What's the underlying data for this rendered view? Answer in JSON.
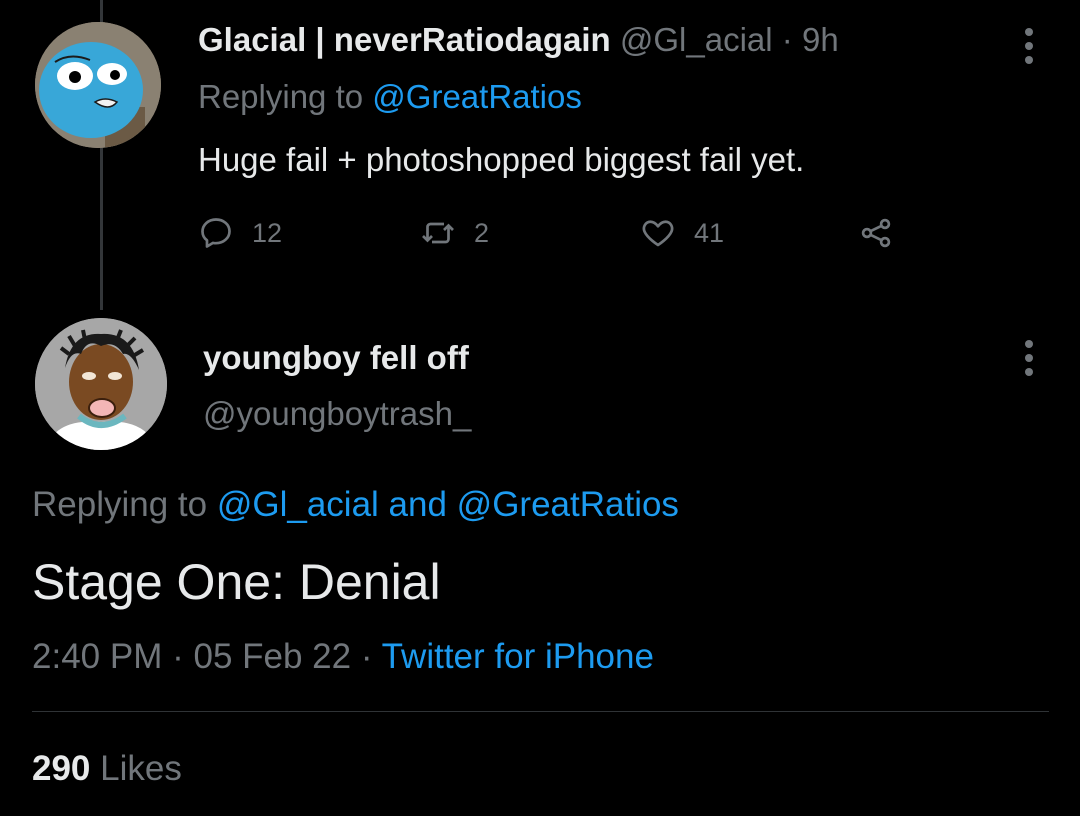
{
  "colors": {
    "background": "#000000",
    "text_primary": "#e7e9ea",
    "text_muted": "#71767b",
    "link": "#1d9bf0",
    "divider": "#2f3336"
  },
  "parent_tweet": {
    "display_name": "Glacial | neverRatiodagain",
    "handle": "@Gl_acial",
    "separator": "·",
    "time": "9h",
    "replying_to_label": "Replying to",
    "replying_to_handle": "@GreatRatios",
    "text": "Huge fail + photoshopped biggest fail yet.",
    "avatar_icon": "cartoon-avatar-icon",
    "more_icon": "more-options-icon",
    "actions": {
      "reply_icon": "reply-icon",
      "reply_count": "12",
      "retweet_icon": "retweet-icon",
      "retweet_count": "2",
      "like_icon": "heart-icon",
      "like_count": "41",
      "share_icon": "share-icon"
    }
  },
  "main_tweet": {
    "display_name": "youngboy fell off",
    "handle": "@youngboytrash_",
    "avatar_icon": "cartoon-avatar-icon",
    "more_icon": "more-options-icon",
    "replying_to_label": "Replying to",
    "replying_to_handles": "@Gl_acial and @GreatRatios",
    "text": "Stage One: Denial",
    "time": "2:40 PM",
    "separator": "·",
    "date": "05 Feb 22",
    "source": "Twitter for iPhone",
    "likes_count": "290",
    "likes_label": "Likes"
  }
}
